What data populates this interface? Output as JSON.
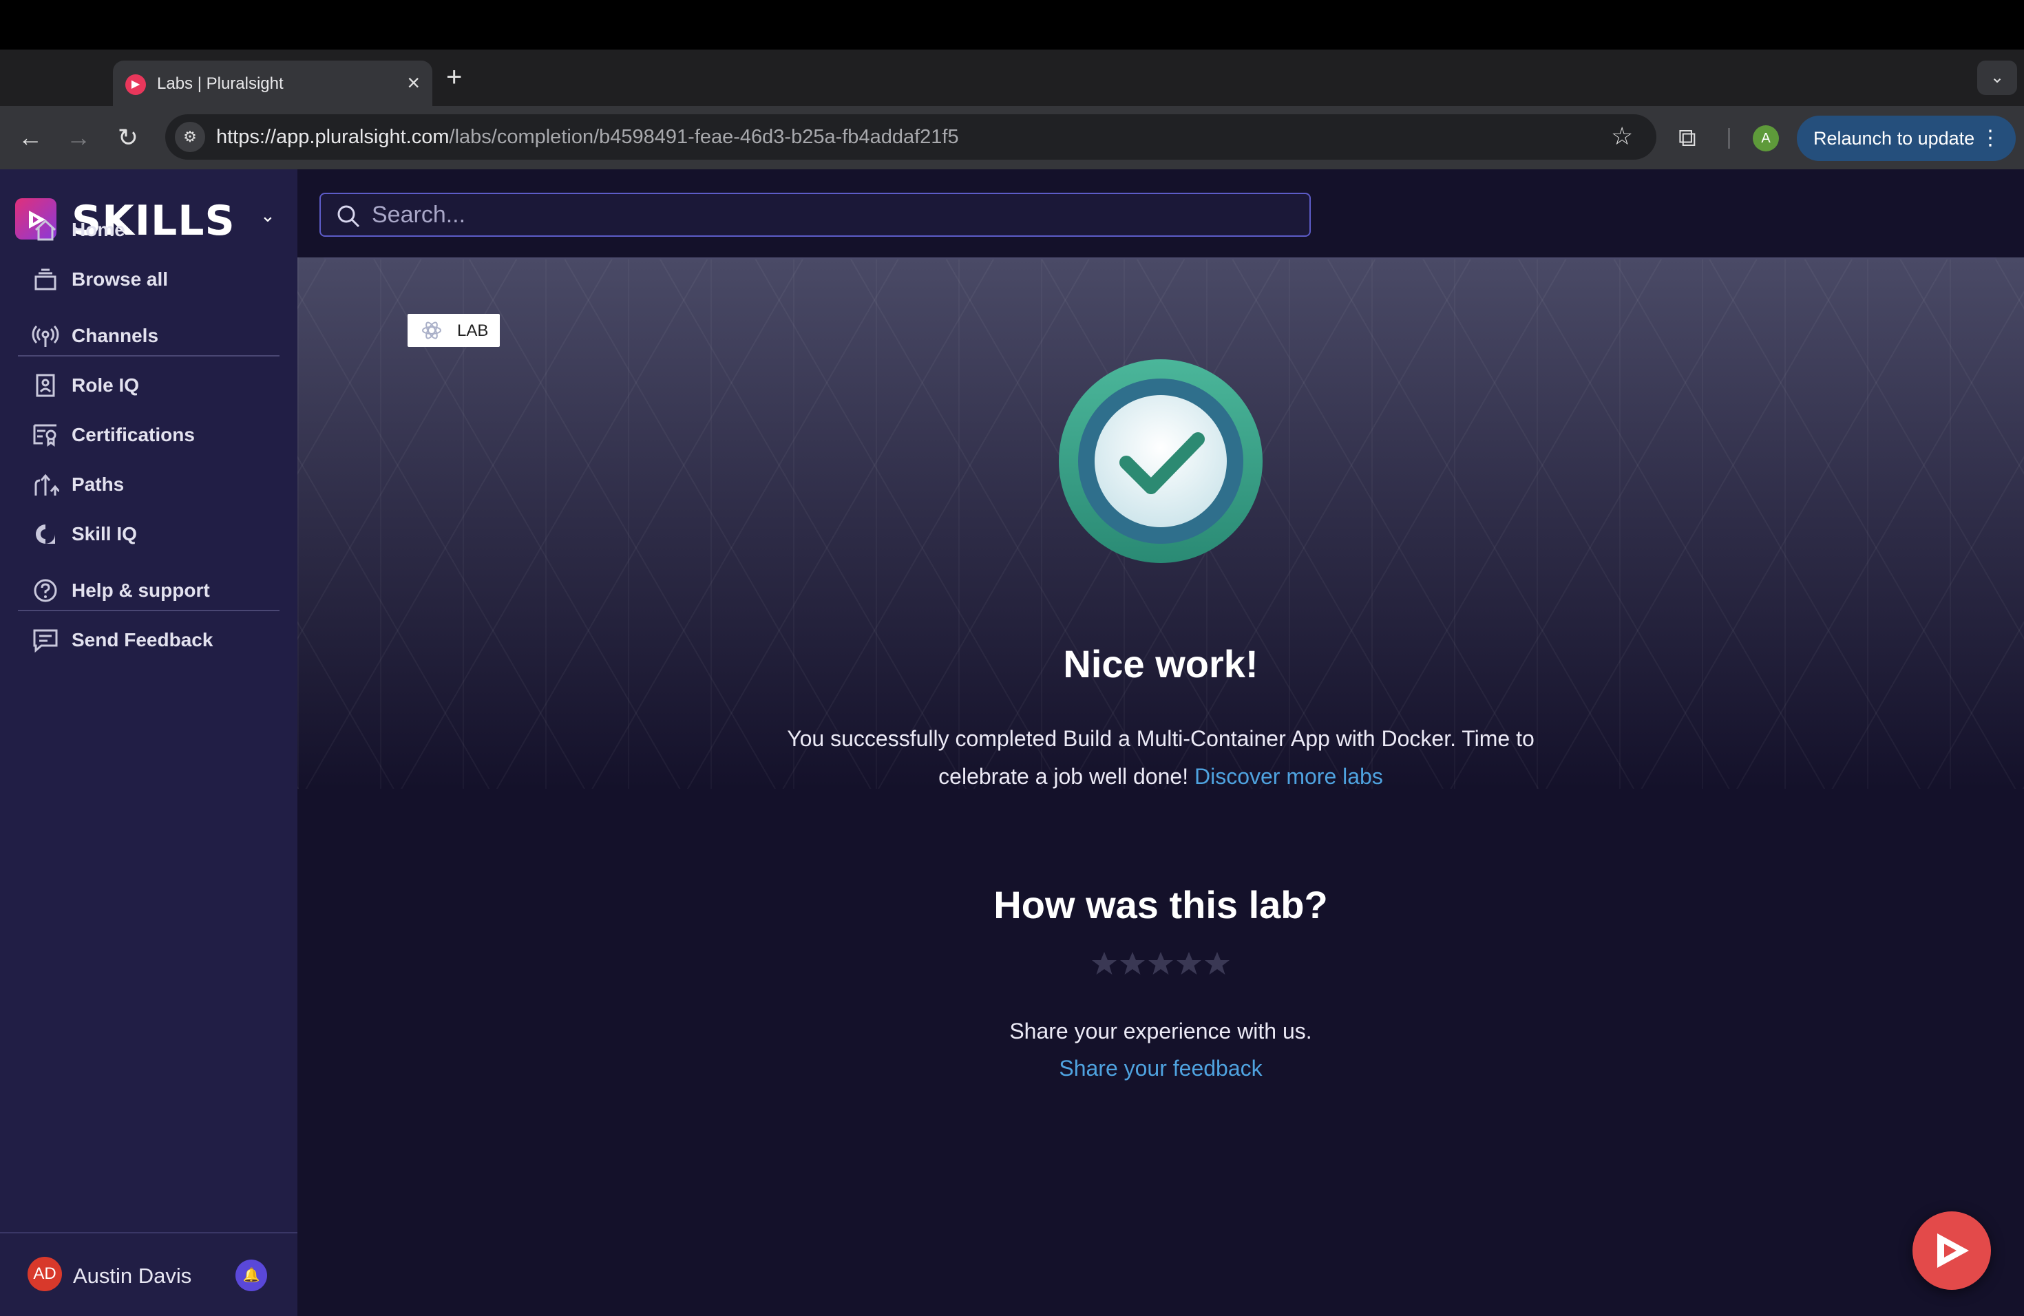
{
  "browser": {
    "tab_title": "Labs | Pluralsight",
    "tab_close": "×",
    "new_tab": "+",
    "url_host": "https://app.pluralsight.com",
    "url_path": "/labs/completion/b4598491-feae-46d3-b25a-fb4addaf21f5",
    "profile_initial": "A",
    "relaunch_label": "Relaunch to update"
  },
  "sidebar": {
    "brand": "SKILLS",
    "items": [
      {
        "label": "Home",
        "icon": "home-icon"
      },
      {
        "label": "Browse all",
        "icon": "stack-icon"
      },
      {
        "label": "Channels",
        "icon": "broadcast-icon"
      },
      {
        "label": "Role IQ",
        "icon": "badge-icon"
      },
      {
        "label": "Certifications",
        "icon": "certificate-icon"
      },
      {
        "label": "Paths",
        "icon": "paths-icon"
      },
      {
        "label": "Skill IQ",
        "icon": "skill-iq-icon"
      },
      {
        "label": "Help & support",
        "icon": "help-icon"
      },
      {
        "label": "Send Feedback",
        "icon": "feedback-icon"
      }
    ],
    "user": {
      "initials": "AD",
      "name": "Austin Davis"
    }
  },
  "search": {
    "placeholder": "Search..."
  },
  "main": {
    "badge": "LAB",
    "title": "Nice work!",
    "message_before": "You successfully completed Build a Multi-Container App with Docker. Time to celebrate a job well done!",
    "message_link": "Discover more labs",
    "rating_title": "How was this lab?",
    "rating": {
      "value": 0,
      "max": 5
    },
    "share_text": "Share your experience with us.",
    "share_link": "Share your feedback"
  },
  "colors": {
    "accent_link": "#4fa3e0",
    "sidebar_bg": "#211e45",
    "main_bg": "#14112a",
    "check_green": "#2e9e86",
    "fab": "#e34a4a"
  }
}
